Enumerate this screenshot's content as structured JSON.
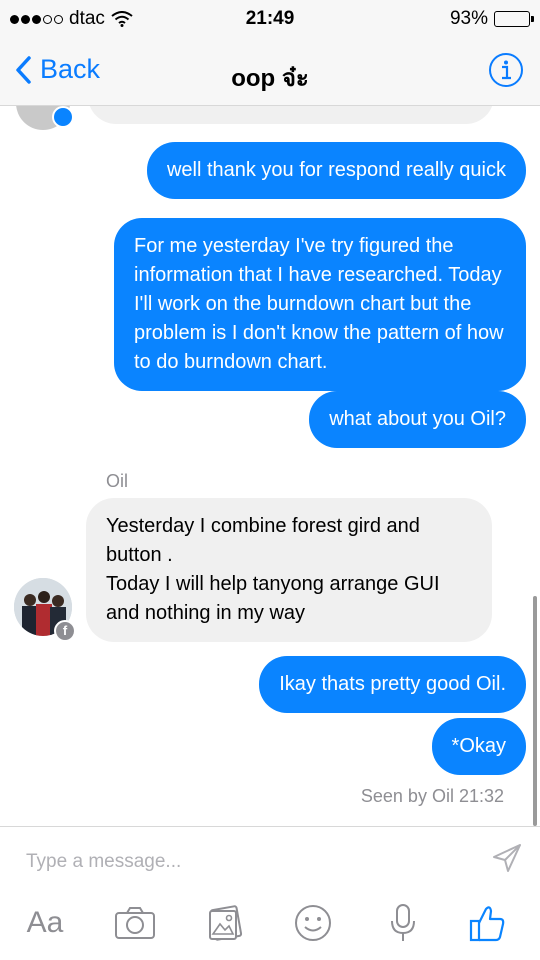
{
  "status": {
    "carrier": "dtac",
    "time": "21:49",
    "battery": "93%",
    "battery_level": 0.93
  },
  "nav": {
    "back_label": "Back",
    "title": "oop จ๋ะ"
  },
  "messages": {
    "out1": "well thank you for respond really quick",
    "out2": "For me yesterday I've try figured the information that I have researched. Today I'll work on the burndown chart but the problem is I don't know the pattern of how to do burndown chart.",
    "out3": "what about you Oil?",
    "sender": "Oil",
    "in1_line1": "Yesterday I combine forest gird and button .",
    "in1_line2": "Today I will help tanyong arrange GUI and nothing in my way",
    "out4": "Ikay thats pretty good Oil.",
    "out5": "*Okay",
    "seen": "Seen by Oil 21:32"
  },
  "compose": {
    "placeholder": "Type a message...",
    "text_button": "Aa"
  },
  "colors": {
    "accent": "#0a84ff",
    "incoming_bg": "#f0f0f0"
  }
}
